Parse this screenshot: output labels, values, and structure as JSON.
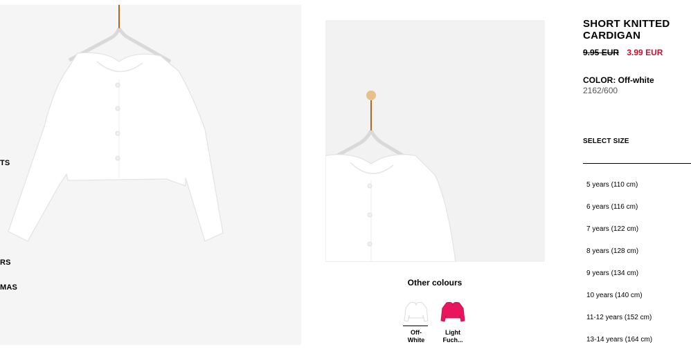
{
  "nav": {
    "items": [
      {
        "label": "TS"
      },
      {
        "label": "RS"
      },
      {
        "label": "MAS"
      }
    ]
  },
  "gallery": {
    "main_alt_icon": "cardigan-on-hanger",
    "thumb_icon": "cardigan-on-hanger"
  },
  "other_colours": {
    "title": "Other colours",
    "swatches": [
      {
        "label_line1": "Off-",
        "label_line2": "White",
        "color": "#ffffff",
        "selected": true
      },
      {
        "label_line1": "Light",
        "label_line2": "Fuch...",
        "color": "#e8175d",
        "selected": false
      }
    ]
  },
  "product": {
    "title_line1": "SHORT KNITTED",
    "title_line2": "CARDIGAN",
    "old_price": "9.95 EUR",
    "new_price": "3.99 EUR",
    "sale_color": "#c8102e",
    "color_label": "COLOR: Off-white",
    "reference": "2162/600"
  },
  "size_selector": {
    "label": "SELECT SIZE",
    "sizes": [
      "5 years (110 cm)",
      "6 years (116 cm)",
      "7 years (122 cm)",
      "8 years (128 cm)",
      "9 years (134 cm)",
      "10 years (140 cm)",
      "11-12 years (152 cm)",
      "13-14 years (164 cm)"
    ]
  }
}
